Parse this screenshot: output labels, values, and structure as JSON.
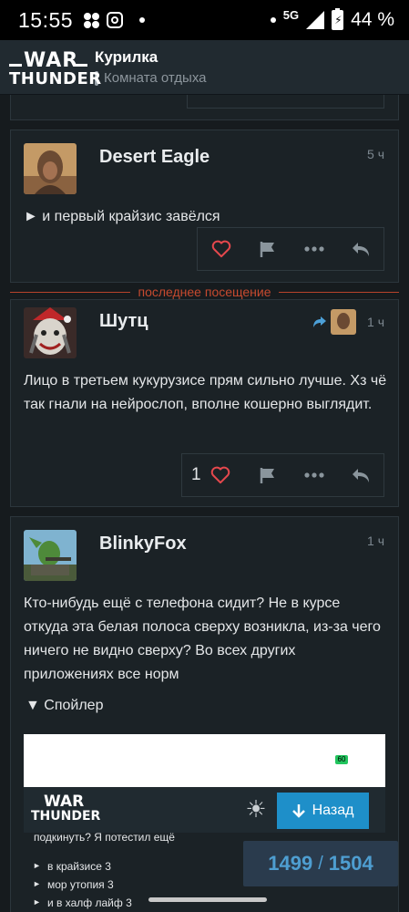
{
  "status_bar": {
    "time": "15:55",
    "network": "5G",
    "battery": "44 %"
  },
  "header": {
    "logo_line1": "WAR",
    "logo_line2": "THUNDER",
    "title": "Курилка",
    "subtitle": "Комната отдыха"
  },
  "posts": [
    {
      "author": "Desert Eagle",
      "time": "5 ч",
      "body": "► и первый крайзис завёлся",
      "likes": ""
    },
    {
      "author": "Шутц",
      "time": "1 ч",
      "body": "Лицо в третьем кукурузисе прям сильно лучше. Хз чё так гнали на нейрослоп, вполне кошерно выглядит.",
      "likes": "1"
    },
    {
      "author": "BlinkyFox",
      "time": "1 ч",
      "body": "Кто-нибудь ещё с телефона сидит? Не в курсе откуда эта белая полоса сверху возникла, из-за чего ничего не видно сверху? Во всех других приложениях все норм",
      "spoiler_label": "▼  Спойлер"
    }
  ],
  "last_visit_label": "последнее посещение",
  "screenshot": {
    "badge": "60",
    "logo_line1": "WAR",
    "logo_line2": "THUNDER",
    "back_label": "Назад",
    "text_line": "подкинуть? Я потестил ещё",
    "items": [
      "в крайзисе 3",
      "мор утопия 3",
      "и в халф лайф 3"
    ]
  },
  "pager": {
    "current": "1499",
    "total": "1504"
  },
  "colors": {
    "background": "#161b1e",
    "card": "#1b2226",
    "accent_red": "#c64a2f",
    "accent_blue": "#1e8fc9",
    "like_heart": "#e5484d"
  }
}
